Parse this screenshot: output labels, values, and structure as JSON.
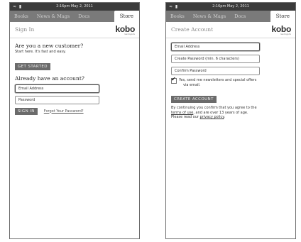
{
  "status_bar": {
    "time": "2:16pm May 2, 2011"
  },
  "tabs": [
    {
      "label": "Books"
    },
    {
      "label": "News & Mags"
    },
    {
      "label": "Docs"
    },
    {
      "label": "Store"
    }
  ],
  "logo": {
    "text": "kobo",
    "sub": "readingLife"
  },
  "sign_in": {
    "title": "Sign In",
    "new_heading": "Are you a new customer?",
    "new_sub": "Start here. It's fast and easy.",
    "get_started": "GET STARTED",
    "existing_heading": "Already have an account?",
    "email_placeholder": "Email Address",
    "password_placeholder": "Password",
    "sign_in_button": "SIGN IN",
    "forgot_link": "Forgot Your Password?"
  },
  "create_account": {
    "title": "Create Account",
    "email_placeholder": "Email Address",
    "password_placeholder": "Create Password (min. 6 characters)",
    "confirm_placeholder": "Confirm Password",
    "newsletter_line1": "Yes, send me newsletters and special offers",
    "newsletter_line2": "via email.",
    "create_button": "CREATE ACCOUNT",
    "terms_line1": "By continuing you confirm that you agree to the",
    "terms_link": "terms of use",
    "terms_mid": ", and are over 13 years of age.",
    "terms_line3_pre": "Please read our ",
    "privacy_link": "privacy policy",
    "terms_line3_post": "."
  }
}
